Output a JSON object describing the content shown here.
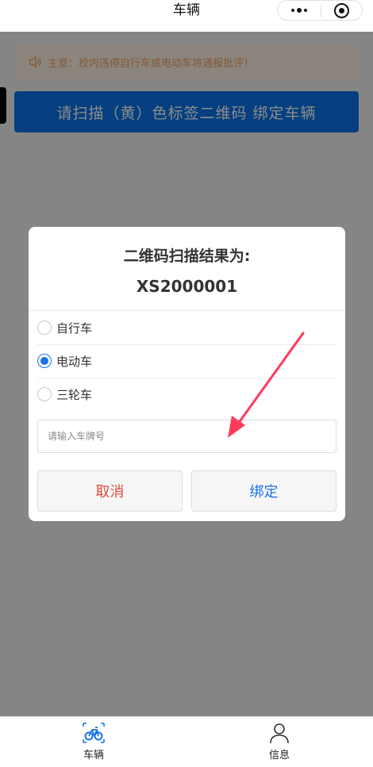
{
  "navbar": {
    "title": "车辆"
  },
  "notice": {
    "text": "主意：校内违停自行车或电动车将通报批评！"
  },
  "scan_button": {
    "label": "请扫描（黄）色标签二维码 绑定车辆"
  },
  "dialog": {
    "title": "二维码扫描结果为:",
    "code": "XS2000001",
    "options": [
      {
        "label": "自行车",
        "checked": false
      },
      {
        "label": "电动车",
        "checked": true
      },
      {
        "label": "三轮车",
        "checked": false
      }
    ],
    "plate_placeholder": "请输入车牌号",
    "plate_value": "",
    "cancel_label": "取消",
    "bind_label": "绑定"
  },
  "tabbar": {
    "items": [
      {
        "label": "车辆",
        "icon": "bicycle-icon",
        "active": true
      },
      {
        "label": "信息",
        "icon": "person-icon",
        "active": false
      }
    ]
  },
  "colors": {
    "primary": "#0a73e8",
    "notice_bg": "#fdf2e6",
    "notice_text": "#f0a060",
    "cancel": "#e04a3a",
    "arrow": "#ff3b5c"
  }
}
